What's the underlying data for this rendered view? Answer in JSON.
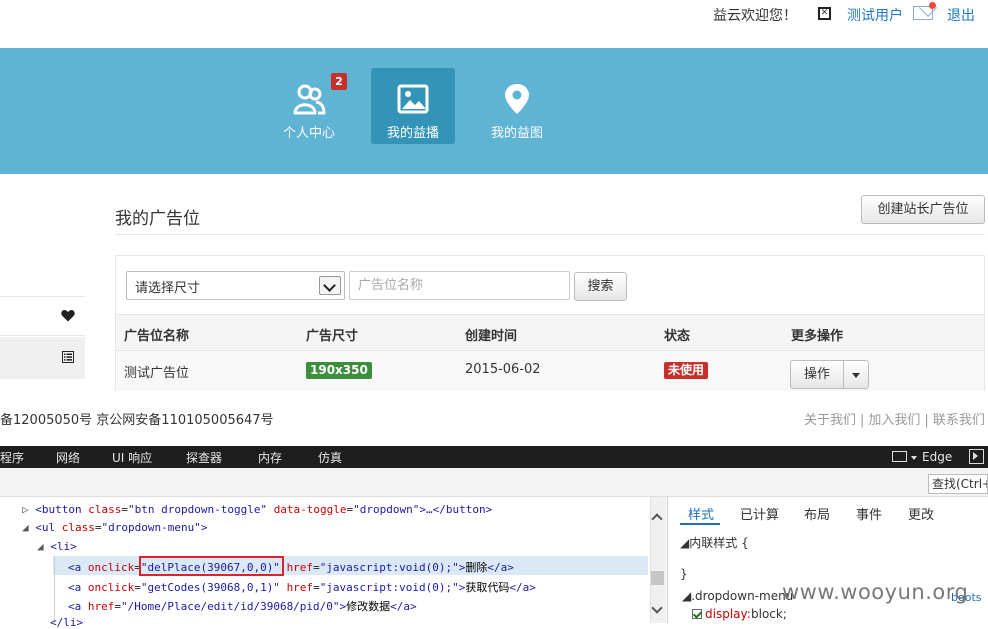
{
  "topbar": {
    "welcome": "益云欢迎您！",
    "close_glyph": "✕",
    "username": "测试用户",
    "logout": "退出"
  },
  "nav": {
    "items": [
      {
        "label": "个人中心",
        "badge": "2"
      },
      {
        "label": "我的益播"
      },
      {
        "label": "我的益图"
      }
    ],
    "active_index": 1
  },
  "page": {
    "title": "我的广告位",
    "create_button": "创建站长广告位"
  },
  "filters": {
    "size_select_value": "请选择尺寸",
    "name_placeholder": "广告位名称",
    "search_button": "搜索"
  },
  "table": {
    "headers": [
      "广告位名称",
      "广告尺寸",
      "创建时间",
      "状态",
      "更多操作"
    ],
    "rows": [
      {
        "name": "测试广告位",
        "size": "190x350",
        "created": "2015-06-02",
        "status": "未使用",
        "action": "操作"
      }
    ]
  },
  "footer": {
    "icp": "备12005050号 京公网安备110105005647号",
    "links": [
      "关于我们",
      "加入我们",
      "联系我们"
    ]
  },
  "devtools": {
    "tabs": [
      "程序",
      "网络",
      "UI 响应",
      "探查器",
      "内存",
      "仿真"
    ],
    "browser_mode": "Edge",
    "find_placeholder": "查找(Ctrl+F)",
    "dom_lines": [
      {
        "tag_open": "<button ",
        "a1": "class",
        "v1": "\"btn dropdown-toggle\"",
        "a2": "data-toggle",
        "v2": "\"dropdown\"",
        "rest": ">…</button>"
      },
      {
        "tag_open": "<ul ",
        "a1": "class",
        "v1": "\"dropdown-menu\"",
        "rest": ">"
      },
      {
        "tag_open": "<li>"
      },
      {
        "tag_open": "<a ",
        "a1": "onclick",
        "v1": "\"delPlace(39067,0,0)\"",
        "a2": "href",
        "v2": "\"javascript:void(0);\"",
        "text": "删除",
        "close": "</a>"
      },
      {
        "tag_open": "<a ",
        "a1": "onclick",
        "v1": "\"getCodes(39068,0,1)\"",
        "a2": "href",
        "v2": "\"javascript:void(0);\"",
        "text": "获取代码",
        "close": "</a>"
      },
      {
        "tag_open": "<a ",
        "a1": "href",
        "v1": "\"/Home/Place/edit/id/39068/pid/0\"",
        "text": "修改数据",
        "close": "</a>"
      },
      {
        "tag_open": "</li>"
      }
    ],
    "styles_tabs": [
      "样式",
      "已计算",
      "布局",
      "事件",
      "更改"
    ],
    "inline_style_label": "内联样式",
    "open_brace": "{",
    "close_brace": "}",
    "rule_selector": ".dropdown-menu",
    "prop_name": "display",
    "prop_value": "block;",
    "source_link": "boots"
  },
  "watermark": "www.wooyun.org",
  "colors": {
    "header_band": "#5fb3d3",
    "active_nav": "#3494b8",
    "badge_red": "#c9302c",
    "size_green": "#3c8d3c",
    "link_blue": "#1f78c6"
  }
}
